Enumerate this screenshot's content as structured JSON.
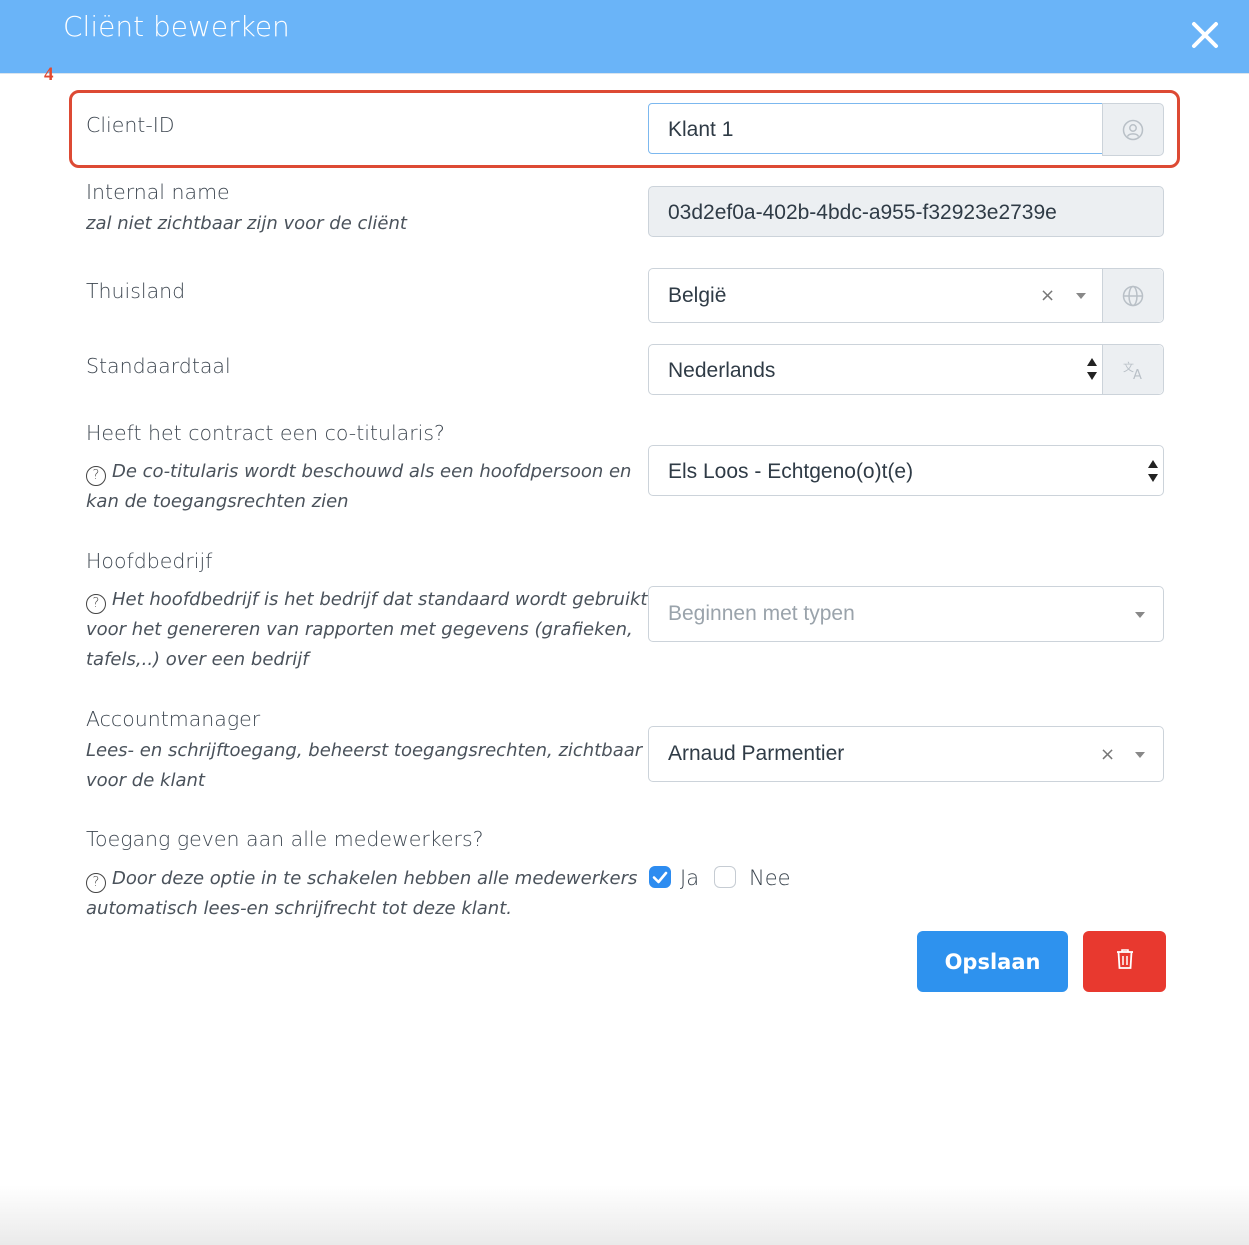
{
  "dialog": {
    "title": "Cliënt bewerken",
    "step_marker": "4"
  },
  "fields": {
    "client_id": {
      "label": "Client-ID",
      "value": "Klant 1",
      "addon_icon": "user-circle-icon"
    },
    "internal_name": {
      "label": "Internal name",
      "hint": "zal niet zichtbaar zijn voor de cliënt",
      "value": "03d2ef0a-402b-4bdc-a955-f32923e2739e"
    },
    "home_country": {
      "label": "Thuisland",
      "value": "België",
      "addon_icon": "globe-icon"
    },
    "default_language": {
      "label": "Standaardtaal",
      "value": "Nederlands",
      "addon_icon": "translate-icon"
    },
    "co_holder": {
      "label": "Heeft het contract een co-titularis?",
      "hint": "De co-titularis wordt beschouwd als een hoofdpersoon en kan de toegangsrechten zien",
      "hint_line1": "De co-titularis wordt beschouwd als een hoofdpersoon en",
      "hint_line2": "kan de toegangsrechten zien",
      "value": "Els Loos - Echtgeno(o)t(e)"
    },
    "main_company": {
      "label": "Hoofdbedrijf",
      "hint_line1": "Het hoofdbedrijf is het bedrijf dat standaard wordt gebruikt",
      "hint_line2": "voor het genereren van rapporten met gegevens (grafieken,",
      "hint_line3": "tafels,..) over een bedrijf",
      "placeholder": "Beginnen met typen"
    },
    "account_manager": {
      "label": "Accountmanager",
      "hint_line1": "Lees- en schrijftoegang, beheerst toegangsrechten, zichtbaar",
      "hint_line2": "voor de klant",
      "value": "Arnaud Parmentier"
    },
    "all_staff_access": {
      "label": "Toegang geven aan alle medewerkers?",
      "hint_line1": "Door deze optie in te schakelen hebben alle medewerkers",
      "hint_line2": "automatisch lees-en schrijfrecht tot deze klant.",
      "options": [
        {
          "label": "Ja",
          "checked": true
        },
        {
          "label": "Nee",
          "checked": false
        }
      ]
    }
  },
  "actions": {
    "save_label": "Opslaan",
    "delete_icon": "trash-icon"
  },
  "colors": {
    "header": "#6ab4f8",
    "primary": "#2e92ee",
    "danger": "#e8392f",
    "highlight": "#dd4a34"
  }
}
